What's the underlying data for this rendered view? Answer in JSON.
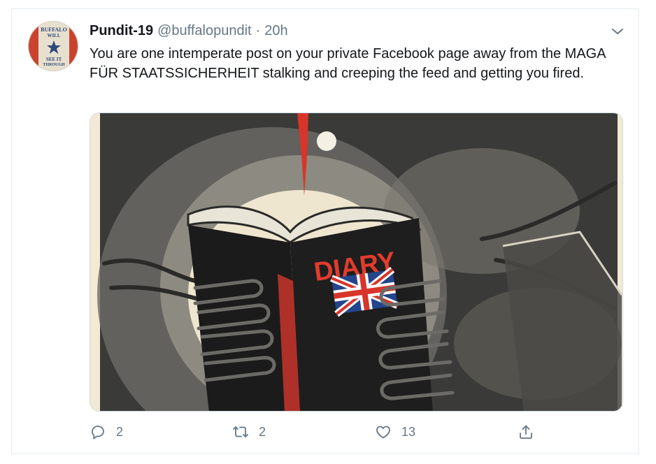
{
  "tweet": {
    "display_name": "Pundit-19",
    "handle": "@buffalopundit",
    "separator": "·",
    "time": "20h",
    "text": "You are one intemperate post on your private Facebook page away from the MAGA FÜR STAATSSICHERHEIT stalking and creeping the feed and getting you fired.",
    "avatar": {
      "line1": "BUFFALO",
      "line2": "WILL",
      "line3": "SEE IT",
      "line4": "THROUGH"
    },
    "media": {
      "book_label": "DIARY"
    },
    "actions": {
      "reply_count": "2",
      "retweet_count": "2",
      "like_count": "13"
    }
  },
  "colors": {
    "text": "#14171a",
    "secondary": "#657786",
    "border": "#e6ecf0",
    "poster_red": "#d8352a",
    "poster_black": "#1b1b1b",
    "poster_cream": "#f2ead5"
  },
  "icons": [
    "chevron-down-icon",
    "reply-icon",
    "retweet-icon",
    "like-icon",
    "share-icon"
  ]
}
